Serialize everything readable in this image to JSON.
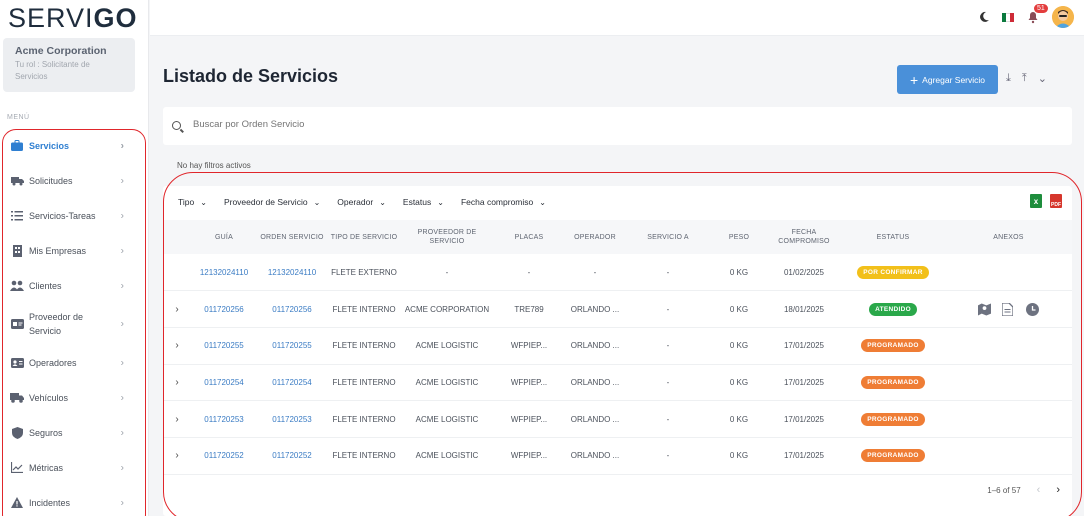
{
  "app": {
    "logo_text": "SERVI",
    "logo_suffix": "GO"
  },
  "org": {
    "name": "Acme Corporation",
    "role": "Tu rol : Solicitante de Servicios"
  },
  "menu_label": "MENÚ",
  "menu": [
    {
      "label": "Servicios",
      "icon": "briefcase-icon",
      "active": true
    },
    {
      "label": "Solicitudes",
      "icon": "truck-edit-icon"
    },
    {
      "label": "Servicios-Tareas",
      "icon": "list-icon"
    },
    {
      "label": "Mis Empresas",
      "icon": "building-icon"
    },
    {
      "label": "Clientes",
      "icon": "users-icon"
    },
    {
      "label": "Proveedor de Servicio",
      "icon": "id-card-icon"
    },
    {
      "label": "Operadores",
      "icon": "contact-card-icon"
    },
    {
      "label": "Vehículos",
      "icon": "truck-icon"
    },
    {
      "label": "Seguros",
      "icon": "shield-icon"
    },
    {
      "label": "Métricas",
      "icon": "chart-line-icon"
    },
    {
      "label": "Incidentes",
      "icon": "warning-icon"
    }
  ],
  "topbar": {
    "notification_count": "51"
  },
  "page": {
    "title": "Listado de Servicios",
    "add_button": "Agregar Servicio"
  },
  "search": {
    "placeholder": "Buscar por Orden Servicio"
  },
  "filters_status": "No hay filtros activos",
  "filter_dropdowns": [
    "Tipo",
    "Proveedor de Servicio",
    "Operador",
    "Estatus",
    "Fecha compromiso"
  ],
  "table": {
    "headers": [
      "",
      "Guía",
      "Orden Servicio",
      "Tipo de Servicio",
      "Proveedor de Servicio",
      "Placas",
      "Operador",
      "Servicio a",
      "Peso",
      "Fecha Compromiso",
      "Estatus",
      "Anexos"
    ],
    "rows": [
      {
        "expand": "",
        "guia": "12132024110",
        "orden": "12132024110",
        "tipo": "FLETE EXTERNO",
        "proveedor": "-",
        "placas": "-",
        "operador": "-",
        "servicio_a": "-",
        "peso": "0 KG",
        "fecha": "01/02/2025",
        "estatus": "POR CONFIRMAR",
        "estatus_color": "#f2c01a",
        "anexos": false
      },
      {
        "expand": "›",
        "guia": "011720256",
        "orden": "011720256",
        "tipo": "FLETE INTERNO",
        "proveedor": "ACME CORPORATION",
        "placas": "TRE789",
        "operador": "ORLANDO ...",
        "servicio_a": "-",
        "peso": "0 KG",
        "fecha": "18/01/2025",
        "estatus": "ATENDIDO",
        "estatus_color": "#2aa84a",
        "anexos": true
      },
      {
        "expand": "›",
        "guia": "011720255",
        "orden": "011720255",
        "tipo": "FLETE INTERNO",
        "proveedor": "ACME LOGISTIC",
        "placas": "WFPIEP...",
        "operador": "ORLANDO ...",
        "servicio_a": "-",
        "peso": "0 KG",
        "fecha": "17/01/2025",
        "estatus": "PROGRAMADO",
        "estatus_color": "#ef7d35",
        "anexos": false
      },
      {
        "expand": "›",
        "guia": "011720254",
        "orden": "011720254",
        "tipo": "FLETE INTERNO",
        "proveedor": "ACME LOGISTIC",
        "placas": "WFPIEP...",
        "operador": "ORLANDO ...",
        "servicio_a": "-",
        "peso": "0 KG",
        "fecha": "17/01/2025",
        "estatus": "PROGRAMADO",
        "estatus_color": "#ef7d35",
        "anexos": false
      },
      {
        "expand": "›",
        "guia": "011720253",
        "orden": "011720253",
        "tipo": "FLETE INTERNO",
        "proveedor": "ACME LOGISTIC",
        "placas": "WFPIEP...",
        "operador": "ORLANDO ...",
        "servicio_a": "-",
        "peso": "0 KG",
        "fecha": "17/01/2025",
        "estatus": "PROGRAMADO",
        "estatus_color": "#ef7d35",
        "anexos": false
      },
      {
        "expand": "›",
        "guia": "011720252",
        "orden": "011720252",
        "tipo": "FLETE INTERNO",
        "proveedor": "ACME LOGISTIC",
        "placas": "WFPIEP...",
        "operador": "ORLANDO ...",
        "servicio_a": "-",
        "peso": "0 KG",
        "fecha": "17/01/2025",
        "estatus": "PROGRAMADO",
        "estatus_color": "#ef7d35",
        "anexos": false
      }
    ]
  },
  "pagination": {
    "range": "1–6 of 57"
  },
  "colors": {
    "accent": "#4a90d9",
    "annotation": "#e0262b"
  }
}
